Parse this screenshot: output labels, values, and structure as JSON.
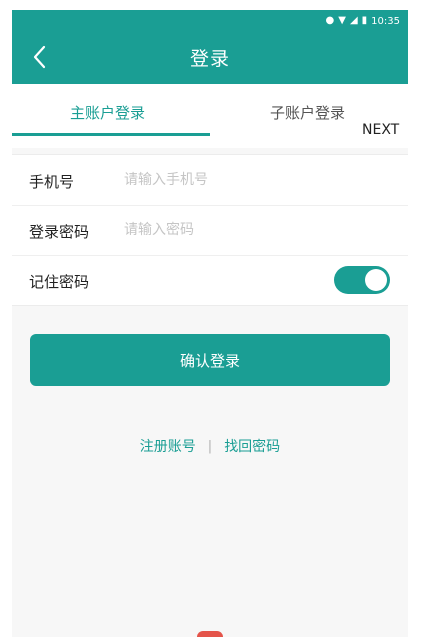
{
  "status_bar": {
    "time": "10:35",
    "icons": [
      "location-icon",
      "wifi-icon",
      "signal-icon",
      "battery-icon"
    ]
  },
  "header": {
    "title": "登录",
    "back_icon": "chevron-left-icon"
  },
  "tabs": {
    "main_label": "主账户登录",
    "sub_label": "子账户登录",
    "next_label": "NEXT"
  },
  "form": {
    "phone_label": "手机号",
    "phone_placeholder": "请输入手机号",
    "password_label": "登录密码",
    "password_placeholder": "请输入密码",
    "remember_label": "记住密码",
    "remember_on": true
  },
  "actions": {
    "confirm_label": "确认登录",
    "register_label": "注册账号",
    "divider": "|",
    "recover_label": "找回密码"
  },
  "colors": {
    "accent": "#1a9e94",
    "background": "#f7f7f7"
  }
}
